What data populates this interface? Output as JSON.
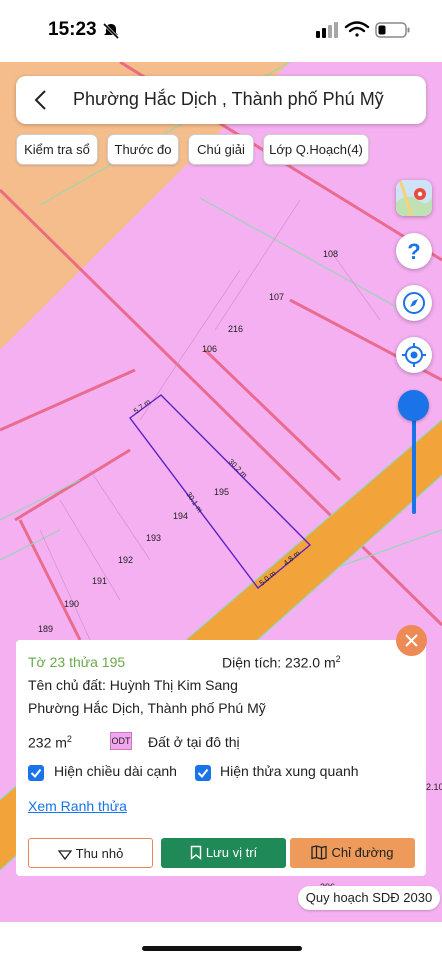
{
  "status_bar": {
    "time": "15:23"
  },
  "search": {
    "title": "Phường Hắc Dịch , Thành phố Phú Mỹ"
  },
  "toolbar": {
    "chips": [
      {
        "label": "Kiểm tra sổ"
      },
      {
        "label": "Thước đo"
      },
      {
        "label": "Chú giải"
      },
      {
        "label": "Lớp Q.Hoạch(4)"
      }
    ]
  },
  "map": {
    "parcel_labels": [
      "108",
      "107",
      "216",
      "106",
      "195",
      "194",
      "193",
      "192",
      "191",
      "190",
      "189",
      "2.10",
      "206"
    ],
    "edge_labels": [
      "5.7 m",
      "30.2 m",
      "30.1 m",
      "5.0 m",
      "4.8 m"
    ],
    "colors": {
      "residential": "#f4b0f0",
      "commercial": "#f6bd8c",
      "road": "#f2a33a",
      "parcel_border": "#e8607f",
      "selected_outline": "#5b20c8"
    },
    "zoom_level": 0.12
  },
  "map_tools": {
    "layers_icon": "map-layers-icon",
    "help_icon": "help-icon",
    "compass_icon": "compass-icon",
    "locate_icon": "locate-icon"
  },
  "info": {
    "parcel_id": "Tờ 23 thửa 195",
    "area_label": "Diện tích: 232.0 m",
    "area_sup": "2",
    "owner": "Tên chủ đất: Huỳnh Thị Kim Sang",
    "address": "Phường Hắc Dịch, Thành phố Phú Mỹ",
    "size_value": "232 m",
    "size_sup": "2",
    "land_code": "ODT",
    "land_type": "Đất ở tại đô thị",
    "checkbox_edges": "Hiện chiều dài cạnh",
    "checkbox_neighbors": "Hiện thửa xung quanh",
    "view_link": "Xem Ranh thửa",
    "buttons": {
      "shrink": "Thu nhỏ",
      "save": "Lưu vị trí",
      "direction": "Chỉ đường"
    }
  },
  "plan_badge": "Quy hoạch SDĐ 2030"
}
